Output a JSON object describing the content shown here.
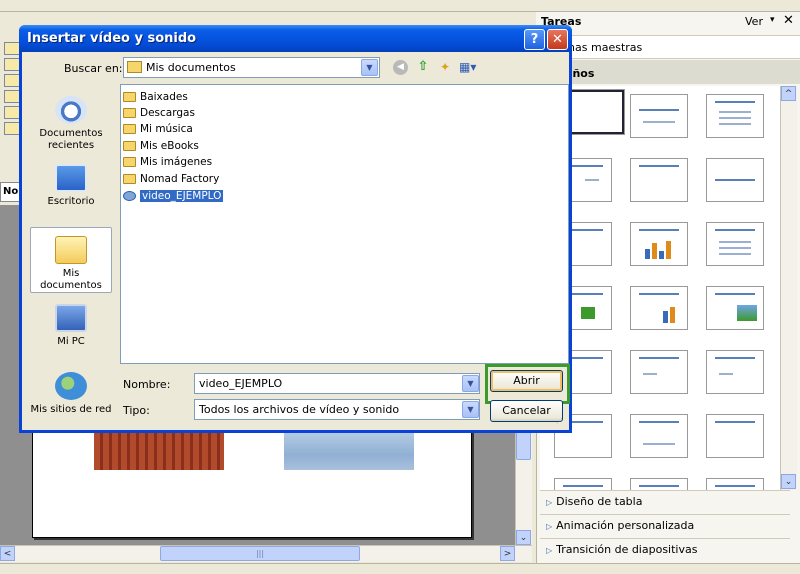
{
  "dialog": {
    "title": "Insertar vídeo y sonido",
    "help_label": "?",
    "close_label": "✕",
    "look_in_label": "Buscar en:",
    "look_in_value": "Mis documentos",
    "dropdown_arrow": "▼",
    "views_label": "▦▾",
    "places": [
      "Documentos recientes",
      "Escritorio",
      "Mis documentos",
      "Mi PC",
      "Mis sitios de red"
    ],
    "files": [
      "Baixades",
      "Descargas",
      "Mi música",
      "Mis eBooks",
      "Mis imágenes",
      "Nomad Factory",
      "video_EJEMPLO"
    ],
    "name_label": "Nombre:",
    "name_value": "video_EJEMPLO",
    "type_label": "Tipo:",
    "type_value": "Todos los archivos de vídeo y sonido",
    "open_label": "Abrir",
    "cancel_label": "Cancelar"
  },
  "background": {
    "left_tab_label": "Nor",
    "scroll_left": "<",
    "scroll_right": ">",
    "scroll_down": "⌄",
    "hthumb_grip": "|||"
  },
  "taskpane": {
    "title": "Tareas",
    "view_label": "Ver",
    "view_arrow": "▾",
    "close_label": "✕",
    "section_masters": "inas maestras",
    "section_designs": "eños",
    "links": [
      "Diseño de tabla",
      "Animación personalizada",
      "Transición de diapositivas"
    ],
    "link_marker": "▷",
    "scroll_up": "^",
    "scroll_down": "⌄"
  },
  "colors": {
    "title_bar": "#0654e0",
    "selection": "#316ac5",
    "highlight_outline": "#3c9a2c"
  }
}
